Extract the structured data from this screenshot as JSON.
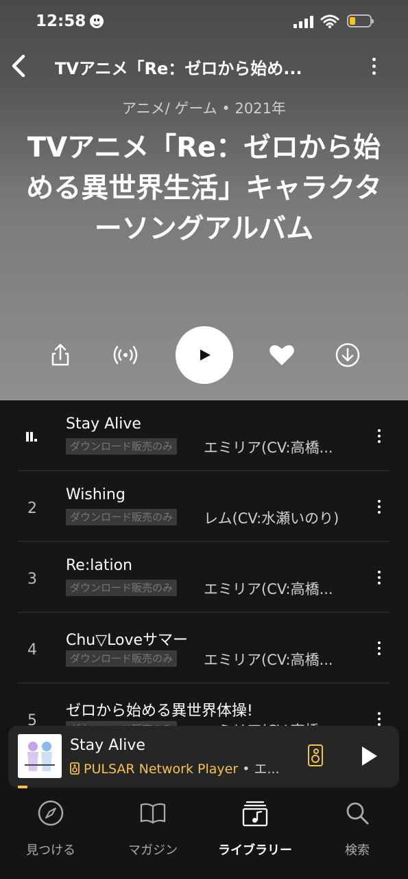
{
  "status_bar": {
    "time": "12:58"
  },
  "header": {
    "title": "TVアニメ「Re：ゼロから始め..."
  },
  "album": {
    "meta": "アニメ/ ゲーム • 2021年",
    "title": "TVアニメ「Re：ゼロから始める異世界生活」キャラクターソングアルバム"
  },
  "actions": [
    "share-icon",
    "broadcast-icon",
    "play-icon",
    "heart-icon",
    "download-icon"
  ],
  "tracks": [
    {
      "num": "",
      "title": "Stay Alive",
      "badge": "ダウンロード販売のみ",
      "artist": "エミリア(CV:高橋...",
      "playing": true
    },
    {
      "num": "2",
      "title": "Wishing",
      "badge": "ダウンロード販売のみ",
      "artist": "レム(CV:水瀬いのり)"
    },
    {
      "num": "3",
      "title": "Re:lation",
      "badge": "ダウンロード販売のみ",
      "artist": "エミリア(CV:高橋..."
    },
    {
      "num": "4",
      "title": "Chu▽Loveサマー",
      "badge": "ダウンロード販売のみ",
      "artist": "エミリア(CV:高橋..."
    },
    {
      "num": "5",
      "title": "ゼロから始める異世界体操!",
      "badge": "ダウンロード販売のみ",
      "artist": "エミリア(CV:高橋..."
    }
  ],
  "mini_player": {
    "title": "Stay Alive",
    "device": "PULSAR Network Player",
    "artist": " • エ..."
  },
  "nav": [
    {
      "label": "見つける",
      "icon": "compass-icon"
    },
    {
      "label": "マガジン",
      "icon": "book-icon"
    },
    {
      "label": "ライブラリー",
      "icon": "library-icon",
      "active": true
    },
    {
      "label": "検索",
      "icon": "search-icon"
    }
  ],
  "colors": {
    "accent": "#f5c24a",
    "background": "#141414"
  }
}
